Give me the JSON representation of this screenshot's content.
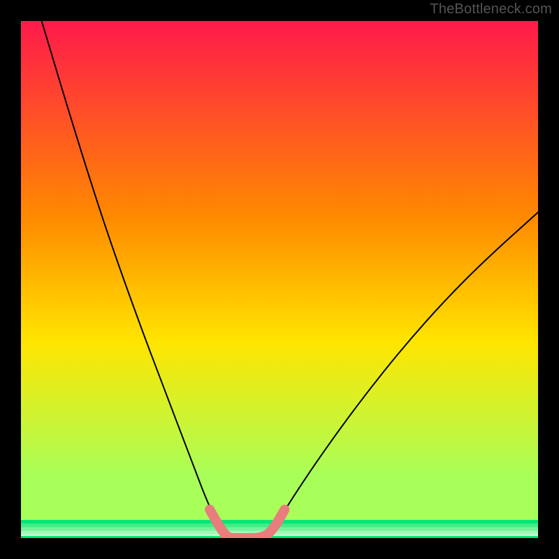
{
  "watermark": "TheBottleneck.com",
  "chart_data": {
    "type": "line",
    "title": "",
    "xlabel": "",
    "ylabel": "",
    "xlim": [
      0,
      1
    ],
    "ylim": [
      0,
      1
    ],
    "grid": false,
    "legend": false,
    "background_gradient": {
      "top_color": "#ff1a4b",
      "mid_color_1": "#ff8a00",
      "mid_color_2": "#ffe500",
      "bottom_color_1": "#a8ff5a",
      "bottom_color_2": "#00e676"
    },
    "series": [
      {
        "name": "bottleneck-curve",
        "style": "thin-black",
        "x": [
          0.04,
          0.1,
          0.16,
          0.22,
          0.28,
          0.33,
          0.36,
          0.385,
          0.4,
          0.42,
          0.47,
          0.49,
          0.52,
          0.58,
          0.66,
          0.74,
          0.82,
          0.9,
          1.0
        ],
        "y": [
          1.0,
          0.8,
          0.61,
          0.44,
          0.28,
          0.15,
          0.07,
          0.02,
          0.0,
          0.0,
          0.0,
          0.02,
          0.07,
          0.16,
          0.27,
          0.37,
          0.46,
          0.54,
          0.63
        ]
      },
      {
        "name": "optimal-zone-highlight",
        "style": "thick-salmon",
        "x": [
          0.365,
          0.385,
          0.4,
          0.42,
          0.47,
          0.49,
          0.51
        ],
        "y": [
          0.055,
          0.02,
          0.0,
          0.0,
          0.0,
          0.02,
          0.055
        ]
      }
    ],
    "bottom_stripes": [
      {
        "y": 0.035,
        "color": "#00e676"
      },
      {
        "y": 0.028,
        "color": "#43ec85"
      },
      {
        "y": 0.021,
        "color": "#74f29a"
      },
      {
        "y": 0.014,
        "color": "#a4f7b5"
      },
      {
        "y": 0.007,
        "color": "#d0fbd5"
      }
    ]
  }
}
